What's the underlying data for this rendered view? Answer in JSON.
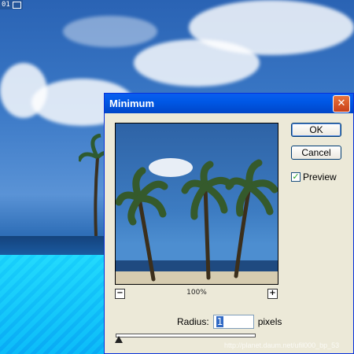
{
  "corner_tag": {
    "number": "01"
  },
  "dialog": {
    "title": "Minimum",
    "close_icon": "close-icon"
  },
  "buttons": {
    "ok": "OK",
    "cancel": "Cancel"
  },
  "preview_checkbox": {
    "label": "Preview",
    "checked": true
  },
  "zoom": {
    "minus": "−",
    "plus": "+",
    "level": "100%"
  },
  "radius": {
    "label": "Radius:",
    "value": "1",
    "unit": "pixels"
  },
  "watermark": "http://planet.daum.net/ufil000_bp_53"
}
